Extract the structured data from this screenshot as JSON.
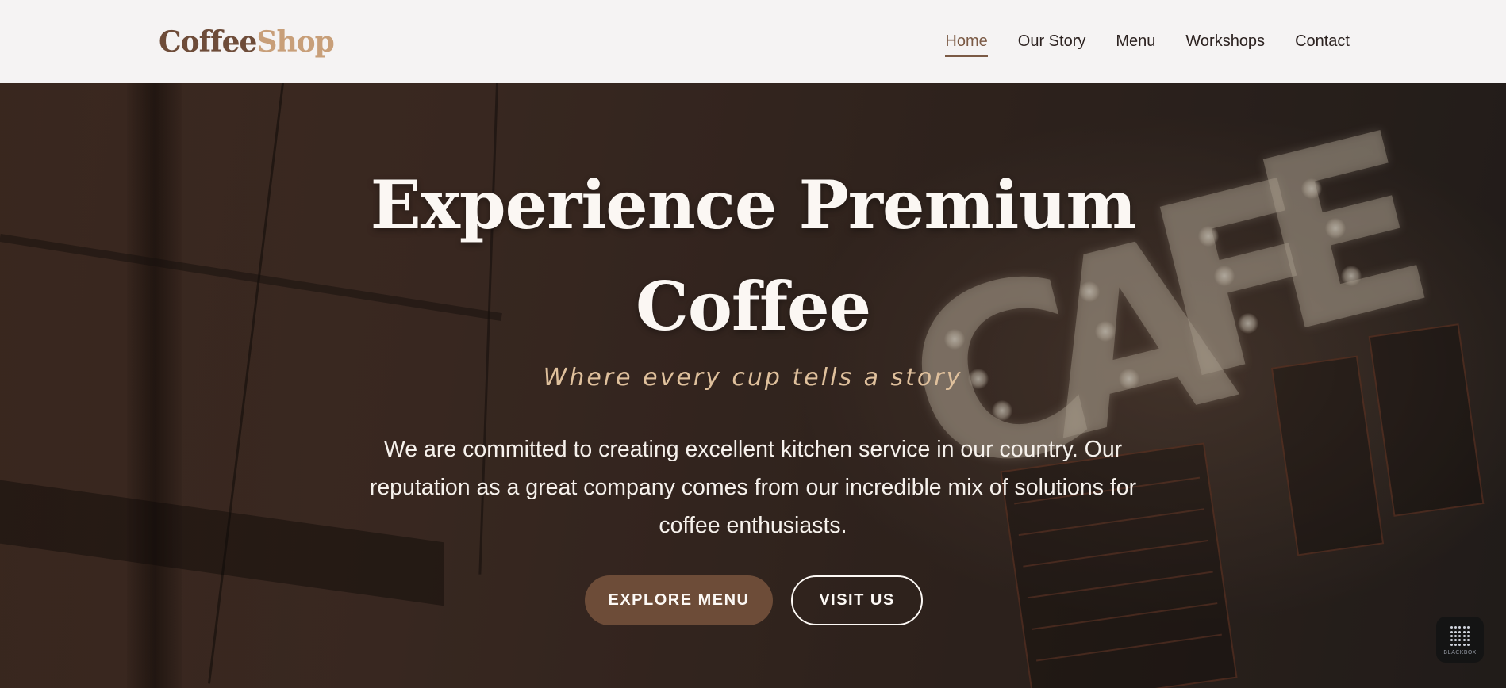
{
  "brand": {
    "part1": "Coffee",
    "part2": "Shop",
    "colors": {
      "part1": "#6e4c39",
      "part2": "#c89f79"
    }
  },
  "nav": {
    "items": [
      {
        "label": "Home",
        "active": true
      },
      {
        "label": "Our Story",
        "active": false
      },
      {
        "label": "Menu",
        "active": false
      },
      {
        "label": "Workshops",
        "active": false
      },
      {
        "label": "Contact",
        "active": false
      }
    ]
  },
  "hero": {
    "title_line1": "Experience Premium",
    "title_line2": "Coffee",
    "tagline": "Where every cup tells a story",
    "description": "We are committed to creating excellent kitchen service in our country. Our reputation as a great company comes from our incredible mix of solutions for coffee enthusiasts.",
    "buttons": {
      "primary": "EXPLORE MENU",
      "secondary": "VISIT US"
    }
  },
  "widget": {
    "label": "BLACKBOX",
    "icon": "blackbox-logo-icon"
  },
  "colors": {
    "accent": "#6d4c38",
    "tagline": "#dfc09c",
    "nav_background": "#f5f3f3"
  }
}
